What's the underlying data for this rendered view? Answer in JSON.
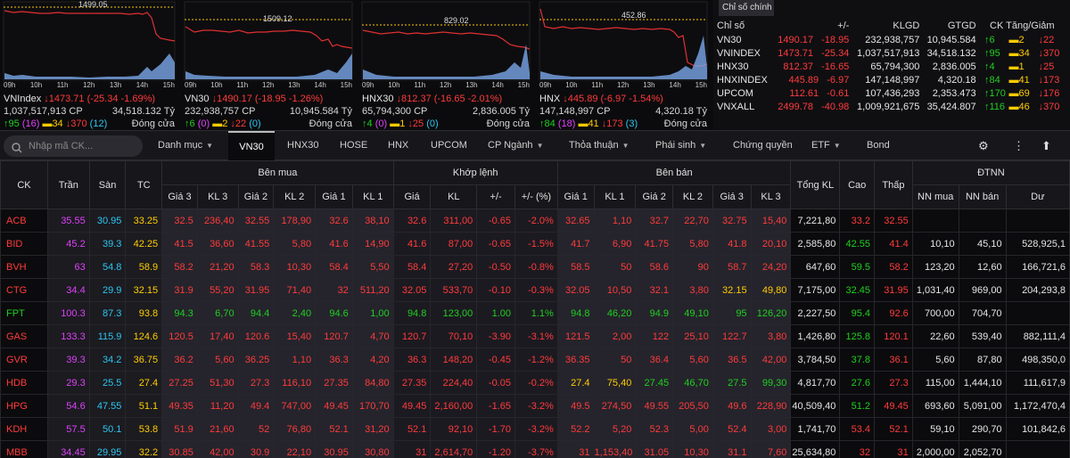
{
  "charts": [
    {
      "name": "VNIndex",
      "ref_label": "1499.05",
      "l1": "↓1473.71 (-25.34 -1.69%)",
      "l1_head": "VNIndex",
      "vol": "1,037,517,913 CP",
      "val": "34,518.132 Tỷ",
      "up": "95",
      "ceil": "(16)",
      "ref": "34",
      "down": "370",
      "floor": "(12)",
      "status": "Đóng cửa",
      "times": [
        "09h",
        "10h",
        "11h",
        "12h",
        "13h",
        "14h",
        "15h"
      ]
    },
    {
      "name": "VN30",
      "ref_label": "1509.12",
      "l1_head": "VN30",
      "l1": "↓1490.17 (-18.95 -1.26%)",
      "vol": "232,938,757 CP",
      "val": "10,945.584 Tỷ",
      "up": "6",
      "ceil": "(0)",
      "ref": "2",
      "down": "22",
      "floor": "(0)",
      "status": "Đóng cửa",
      "times": [
        "09h",
        "10h",
        "11h",
        "12h",
        "13h",
        "14h",
        "15h"
      ]
    },
    {
      "name": "HNX30",
      "ref_label": "829.02",
      "l1_head": "HNX30",
      "l1": "↓812.37 (-16.65 -2.01%)",
      "vol": "65,794,300 CP",
      "val": "2,836.005 Tỷ",
      "up": "4",
      "ceil": "(0)",
      "ref": "1",
      "down": "25",
      "floor": "(0)",
      "status": "Đóng cửa",
      "times": [
        "09h",
        "10h",
        "11h",
        "12h",
        "13h",
        "14h",
        "15h"
      ]
    },
    {
      "name": "HNX",
      "ref_label": "452.86",
      "l1_head": "HNX",
      "l1": "↓445.89 (-6.97 -1.54%)",
      "vol": "147,148,997 CP",
      "val": "4,320.18 Tỷ",
      "up": "84",
      "ceil": "(18)",
      "ref": "41",
      "down": "173",
      "floor": "(3)",
      "status": "Đóng cửa",
      "times": [
        "09h",
        "10h",
        "11h",
        "12h",
        "13h",
        "14h",
        "15h"
      ]
    }
  ],
  "summary": {
    "title": "Chỉ số chính",
    "headers": [
      "Chỉ số",
      "+/-",
      "KLGD",
      "GTGD",
      "CK Tăng/Giảm"
    ],
    "rows": [
      {
        "n": "VN30",
        "v": "1490.17",
        "c": "-18.95",
        "k": "232,938,757",
        "g": "10,945.584",
        "u": "6",
        "r": "2",
        "d": "22"
      },
      {
        "n": "VNINDEX",
        "v": "1473.71",
        "c": "-25.34",
        "k": "1,037,517,913",
        "g": "34,518.132",
        "u": "95",
        "r": "34",
        "d": "370"
      },
      {
        "n": "HNX30",
        "v": "812.37",
        "c": "-16.65",
        "k": "65,794,300",
        "g": "2,836.005",
        "u": "4",
        "r": "1",
        "d": "25"
      },
      {
        "n": "HNXINDEX",
        "v": "445.89",
        "c": "-6.97",
        "k": "147,148,997",
        "g": "4,320.18",
        "u": "84",
        "r": "41",
        "d": "173"
      },
      {
        "n": "UPCOM",
        "v": "112.61",
        "c": "-0.61",
        "k": "107,436,293",
        "g": "2,353.473",
        "u": "170",
        "r": "69",
        "d": "176"
      },
      {
        "n": "VNXALL",
        "v": "2499.78",
        "c": "-40.98",
        "k": "1,009,921,675",
        "g": "35,424.807",
        "u": "116",
        "r": "46",
        "d": "370"
      }
    ]
  },
  "toolbar": {
    "search_placeholder": "Nhập mã CK...",
    "tabs": [
      "Danh mục",
      "VN30",
      "HNX30",
      "HOSE",
      "HNX",
      "UPCOM",
      "CP Ngành",
      "Thỏa thuận",
      "Phái sinh",
      "Chứng quyền",
      "ETF",
      "Bond"
    ]
  },
  "grid": {
    "groups": [
      "CK",
      "Trần",
      "Sàn",
      "TC",
      "Bên mua",
      "Khớp lệnh",
      "Bên bán",
      "Tổng KL",
      "Cao",
      "Thấp",
      "ĐTNN"
    ],
    "sub": [
      "Giá 3",
      "KL 3",
      "Giá 2",
      "KL 2",
      "Giá 1",
      "KL 1",
      "Giá",
      "KL",
      "+/-",
      "+/- (%)",
      "Giá 1",
      "KL 1",
      "Giá 2",
      "KL 2",
      "Giá 3",
      "KL 3",
      "NN mua",
      "NN bán",
      "Dư"
    ],
    "rows": [
      [
        "ACB",
        "35.55",
        "30.95",
        "33.25",
        "32.5",
        "236,40",
        "32.55",
        "178,90",
        "32.6",
        "38,10",
        "32.6",
        "311,00",
        "-0.65",
        "-2.0%",
        "32.65",
        "1,10",
        "32.7",
        "22,70",
        "32.75",
        "15,40",
        "7,221,80",
        "33.2",
        "32.55",
        "",
        "",
        ""
      ],
      [
        "BID",
        "45.2",
        "39.3",
        "42.25",
        "41.5",
        "36,60",
        "41.55",
        "5,80",
        "41.6",
        "14,90",
        "41.6",
        "87,00",
        "-0.65",
        "-1.5%",
        "41.7",
        "6,90",
        "41.75",
        "5,80",
        "41.8",
        "20,10",
        "2,585,80",
        "42.55",
        "41.4",
        "10,10",
        "45,10",
        "528,925,1"
      ],
      [
        "BVH",
        "63",
        "54.8",
        "58.9",
        "58.2",
        "21,20",
        "58.3",
        "10,30",
        "58.4",
        "5,50",
        "58.4",
        "27,20",
        "-0.50",
        "-0.8%",
        "58.5",
        "50",
        "58.6",
        "90",
        "58.7",
        "24,20",
        "647,60",
        "59.5",
        "58.2",
        "123,20",
        "12,60",
        "166,721,6"
      ],
      [
        "CTG",
        "34.4",
        "29.9",
        "32.15",
        "31.9",
        "55,20",
        "31.95",
        "71,40",
        "32",
        "511,20",
        "32.05",
        "533,70",
        "-0.10",
        "-0.3%",
        "32.05",
        "10,50",
        "32.1",
        "3,80",
        "32.15",
        "49,80",
        "7,175,00",
        "32.45",
        "31.95",
        "1,031,40",
        "969,00",
        "204,293,8"
      ],
      [
        "FPT",
        "100.3",
        "87.3",
        "93.8",
        "94.3",
        "6,70",
        "94.4",
        "2,40",
        "94.6",
        "1,00",
        "94.8",
        "123,00",
        "1.00",
        "1.1%",
        "94.8",
        "46,20",
        "94.9",
        "49,10",
        "95",
        "126,20",
        "2,227,50",
        "95.4",
        "92.6",
        "700,00",
        "704,70",
        ""
      ],
      [
        "GAS",
        "133.3",
        "115.9",
        "124.6",
        "120.5",
        "17,40",
        "120.6",
        "15,40",
        "120.7",
        "4,70",
        "120.7",
        "70,10",
        "-3.90",
        "-3.1%",
        "121.5",
        "2,00",
        "122",
        "25,10",
        "122.7",
        "3,80",
        "1,426,80",
        "125.8",
        "120.1",
        "22,60",
        "539,40",
        "882,111,4"
      ],
      [
        "GVR",
        "39.3",
        "34.2",
        "36.75",
        "36.2",
        "5,60",
        "36.25",
        "1,10",
        "36.3",
        "4,20",
        "36.3",
        "148,20",
        "-0.45",
        "-1.2%",
        "36.35",
        "50",
        "36.4",
        "5,60",
        "36.5",
        "42,00",
        "3,784,50",
        "37.8",
        "36.1",
        "5,60",
        "87,80",
        "498,350,0"
      ],
      [
        "HDB",
        "29.3",
        "25.5",
        "27.4",
        "27.25",
        "51,30",
        "27.3",
        "116,10",
        "27.35",
        "84,80",
        "27.35",
        "224,40",
        "-0.05",
        "-0.2%",
        "27.4",
        "75,40",
        "27.45",
        "46,70",
        "27.5",
        "99,30",
        "4,817,70",
        "27.6",
        "27.3",
        "115,00",
        "1,444,10",
        "111,617,9"
      ],
      [
        "HPG",
        "54.6",
        "47.55",
        "51.1",
        "49.35",
        "11,20",
        "49.4",
        "747,00",
        "49.45",
        "170,70",
        "49.45",
        "2,160,00",
        "-1.65",
        "-3.2%",
        "49.5",
        "274,50",
        "49.55",
        "205,50",
        "49.6",
        "228,90",
        "40,509,40",
        "51.2",
        "49.45",
        "693,60",
        "5,091,00",
        "1,172,470,4"
      ],
      [
        "KDH",
        "57.5",
        "50.1",
        "53.8",
        "51.9",
        "21,60",
        "52",
        "76,80",
        "52.1",
        "31,20",
        "52.1",
        "92,10",
        "-1.70",
        "-3.2%",
        "52.2",
        "5,20",
        "52.3",
        "5,00",
        "52.4",
        "3,00",
        "1,741,70",
        "53.4",
        "52.1",
        "59,10",
        "290,70",
        "101,842,6"
      ],
      [
        "MBB",
        "34.45",
        "29.95",
        "32.2",
        "30.85",
        "42,00",
        "30.9",
        "22,10",
        "30.95",
        "30,80",
        "31",
        "2,614,70",
        "-1.20",
        "-3.7%",
        "31",
        "1,153,40",
        "31.05",
        "10,30",
        "31.1",
        "7,60",
        "25,634,80",
        "32",
        "31",
        "2,000,00",
        "2,052,70",
        ""
      ]
    ],
    "colors": [
      [
        "r",
        "p",
        "c",
        "y",
        "r",
        "r",
        "r",
        "r",
        "r",
        "r",
        "r",
        "r",
        "r",
        "r",
        "r",
        "r",
        "r",
        "r",
        "r",
        "r",
        "w",
        "r",
        "r",
        "w",
        "w",
        "w"
      ],
      [
        "r",
        "p",
        "c",
        "y",
        "r",
        "r",
        "r",
        "r",
        "r",
        "r",
        "r",
        "r",
        "r",
        "r",
        "r",
        "r",
        "r",
        "r",
        "r",
        "r",
        "w",
        "g",
        "r",
        "w",
        "w",
        "w"
      ],
      [
        "r",
        "p",
        "c",
        "y",
        "r",
        "r",
        "r",
        "r",
        "r",
        "r",
        "r",
        "r",
        "r",
        "r",
        "r",
        "r",
        "r",
        "r",
        "r",
        "r",
        "w",
        "g",
        "r",
        "w",
        "w",
        "w"
      ],
      [
        "r",
        "p",
        "c",
        "y",
        "r",
        "r",
        "r",
        "r",
        "r",
        "r",
        "r",
        "r",
        "r",
        "r",
        "r",
        "r",
        "r",
        "r",
        "y",
        "y",
        "w",
        "g",
        "r",
        "w",
        "w",
        "w"
      ],
      [
        "g",
        "p",
        "c",
        "y",
        "g",
        "g",
        "g",
        "g",
        "g",
        "g",
        "g",
        "g",
        "g",
        "g",
        "g",
        "g",
        "g",
        "g",
        "g",
        "g",
        "w",
        "g",
        "r",
        "w",
        "w",
        "w"
      ],
      [
        "r",
        "p",
        "c",
        "y",
        "r",
        "r",
        "r",
        "r",
        "r",
        "r",
        "r",
        "r",
        "r",
        "r",
        "r",
        "r",
        "r",
        "r",
        "r",
        "r",
        "w",
        "g",
        "r",
        "w",
        "w",
        "w"
      ],
      [
        "r",
        "p",
        "c",
        "y",
        "r",
        "r",
        "r",
        "r",
        "r",
        "r",
        "r",
        "r",
        "r",
        "r",
        "r",
        "r",
        "r",
        "r",
        "r",
        "r",
        "w",
        "g",
        "r",
        "w",
        "w",
        "w"
      ],
      [
        "r",
        "p",
        "c",
        "y",
        "r",
        "r",
        "r",
        "r",
        "r",
        "r",
        "r",
        "r",
        "r",
        "r",
        "y",
        "y",
        "g",
        "g",
        "g",
        "g",
        "w",
        "g",
        "r",
        "w",
        "w",
        "w"
      ],
      [
        "r",
        "p",
        "c",
        "y",
        "r",
        "r",
        "r",
        "r",
        "r",
        "r",
        "r",
        "r",
        "r",
        "r",
        "r",
        "r",
        "r",
        "r",
        "r",
        "r",
        "w",
        "g",
        "r",
        "w",
        "w",
        "w"
      ],
      [
        "r",
        "p",
        "c",
        "y",
        "r",
        "r",
        "r",
        "r",
        "r",
        "r",
        "r",
        "r",
        "r",
        "r",
        "r",
        "r",
        "r",
        "r",
        "r",
        "r",
        "w",
        "r",
        "r",
        "w",
        "w",
        "w"
      ],
      [
        "r",
        "p",
        "c",
        "y",
        "r",
        "r",
        "r",
        "r",
        "r",
        "r",
        "r",
        "r",
        "r",
        "r",
        "r",
        "r",
        "r",
        "r",
        "r",
        "r",
        "w",
        "r",
        "r",
        "w",
        "w",
        "w"
      ]
    ]
  }
}
